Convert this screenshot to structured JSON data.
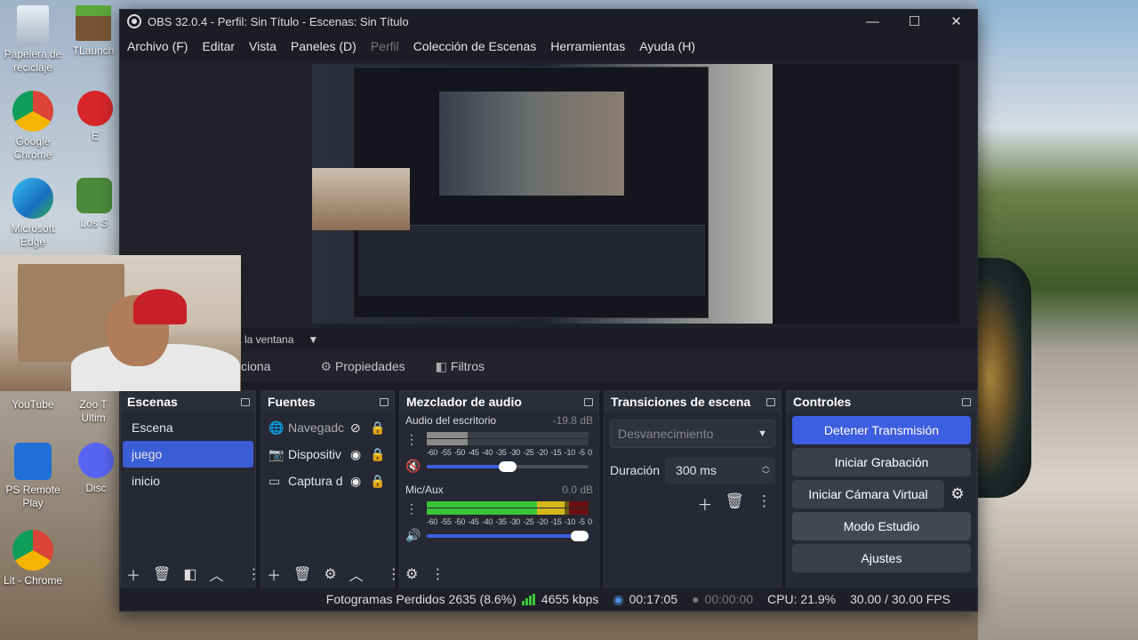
{
  "desktop": {
    "icons": [
      {
        "label": "Papelera de reciclaje",
        "icon": "recycle-bin-icon"
      },
      {
        "label": "TLaunch",
        "icon": "minecraft-launcher-icon"
      },
      {
        "label": "Google Chrome",
        "icon": "chrome-icon"
      },
      {
        "label": "E",
        "icon": "app-icon"
      },
      {
        "label": "Microsoft Edge",
        "icon": "edge-icon"
      },
      {
        "label": "Los S",
        "icon": "game-icon"
      },
      {
        "label": "YouTube",
        "icon": "youtube-icon"
      },
      {
        "label": "Zoo T Ultim",
        "icon": "game-icon"
      },
      {
        "label": "PS Remote Play",
        "icon": "ps-remote-play-icon"
      },
      {
        "label": "Disc",
        "icon": "discord-icon"
      },
      {
        "label": "Lit - Chrome",
        "icon": "chrome-icon"
      }
    ]
  },
  "window": {
    "title": "OBS 32.0.4 - Perfil: Sin Título - Escenas: Sin Título",
    "minimize": "—",
    "maximize": "☐",
    "close": "✕"
  },
  "menu": [
    "Archivo (F)",
    "Editar",
    "Vista",
    "Paneles (D)",
    "Perfil",
    "Colección de Escenas",
    "Herramientas",
    "Ayuda (H)"
  ],
  "source_bar": {
    "text": "a la ventana",
    "caret": "▼"
  },
  "tabs": {
    "selection_label": "ciona",
    "properties": "Propiedades",
    "filters": "Filtros"
  },
  "scenes": {
    "title": "Escenas",
    "items": [
      "Escena",
      "juego",
      "inicio"
    ],
    "selected_index": 1
  },
  "sources": {
    "title": "Fuentes",
    "items": [
      {
        "name": "Navegadc",
        "icon": "browser-icon",
        "visible": false
      },
      {
        "name": "Dispositiv",
        "icon": "camera-icon",
        "visible": true
      },
      {
        "name": "Captura d",
        "icon": "monitor-icon",
        "visible": true
      }
    ]
  },
  "mixer": {
    "title": "Mezclador de audio",
    "scale": [
      "-60",
      "-55",
      "-50",
      "-45",
      "-40",
      "-35",
      "-30",
      "-25",
      "-20",
      "-15",
      "-10",
      "-5",
      "0"
    ],
    "channels": [
      {
        "name": "Audio del escritorio",
        "db": "-19.8 dB",
        "muted": true,
        "volume": 0.5,
        "meter_level": 0.25
      },
      {
        "name": "Mic/Aux",
        "db": "0.0 dB",
        "muted": false,
        "volume": 1.0,
        "meter_level": 0.85
      }
    ]
  },
  "transitions": {
    "title": "Transiciones de escena",
    "selected": "Desvanecimiento",
    "duration_label": "Duración",
    "duration_value": "300 ms"
  },
  "controls": {
    "title": "Controles",
    "stop_stream": "Detener Transmisión",
    "start_recording": "Iniciar Grabación",
    "start_virtual_cam": "Iniciar Cámara Virtual",
    "studio_mode": "Modo Estudio",
    "settings": "Ajustes"
  },
  "status": {
    "dropped_frames": "Fotogramas Perdidos 2635 (8.6%)",
    "bitrate": "4655 kbps",
    "stream_time": "00:17:05",
    "rec_time": "00:00:00",
    "cpu": "CPU: 21.9%",
    "fps": "30.00 / 30.00 FPS"
  },
  "colors": {
    "accent": "#3c5ee0",
    "panel": "#262833",
    "window": "#1b1c24",
    "meter_green": "#38c638"
  }
}
